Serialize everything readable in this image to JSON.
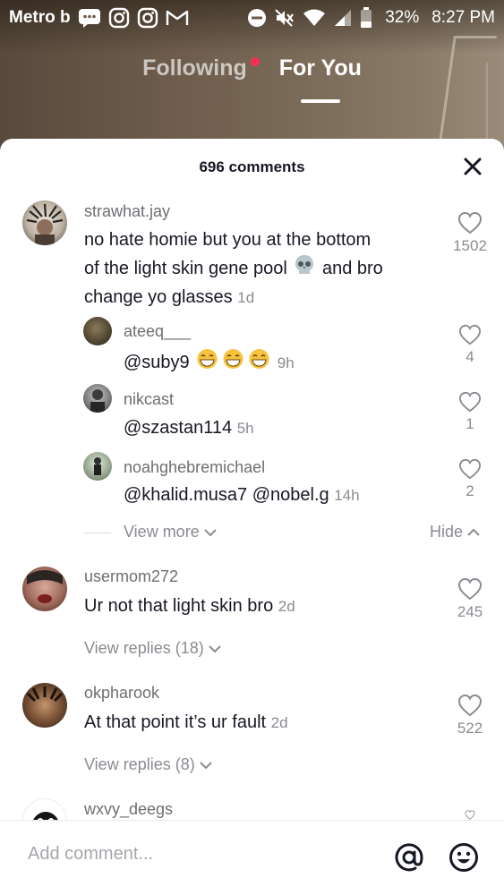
{
  "status_bar": {
    "carrier": "Metro b",
    "battery_pct": "32%",
    "time": "8:27 PM",
    "icons": [
      "message-icon",
      "instagram-icon",
      "instagram-icon",
      "gmail-icon",
      "dnd-icon",
      "mute-icon",
      "wifi-icon",
      "signal-icon",
      "battery-icon"
    ]
  },
  "top_tabs": {
    "following": "Following",
    "for_you": "For You",
    "active": "For You"
  },
  "sheet": {
    "title": "696 comments"
  },
  "comments": [
    {
      "user": "strawhat.jay",
      "text_a": "no hate homie but you at the bottom",
      "text_b": "of the light skin gene pool",
      "text_b2": "and bro",
      "text_c": "change yo glasses",
      "time": "1d",
      "likes": "1502",
      "replies": [
        {
          "user": "ateeq___",
          "text": "@suby9",
          "time": "9h",
          "likes": "4"
        },
        {
          "user": "nikcast",
          "text": "@szastan114",
          "time": "5h",
          "likes": "1"
        },
        {
          "user": "noahghebremichael",
          "text": "@khalid.musa7 @nobel.g",
          "time": "14h",
          "likes": "2"
        }
      ],
      "view_more": "View more",
      "hide": "Hide"
    },
    {
      "user": "usermom272",
      "text": "Ur not that light skin bro",
      "time": "2d",
      "likes": "245",
      "view_replies": "View replies (18)"
    },
    {
      "user": "okpharook",
      "text": "At that point it’s ur fault",
      "time": "2d",
      "likes": "522",
      "view_replies": "View replies (8)"
    },
    {
      "user": "wxvy_deegs"
    }
  ],
  "bottom_bar": {
    "placeholder": "Add comment..."
  },
  "colors": {
    "accent": "#fe2c55",
    "text_primary": "#161823",
    "text_secondary": "#8a8b91"
  }
}
